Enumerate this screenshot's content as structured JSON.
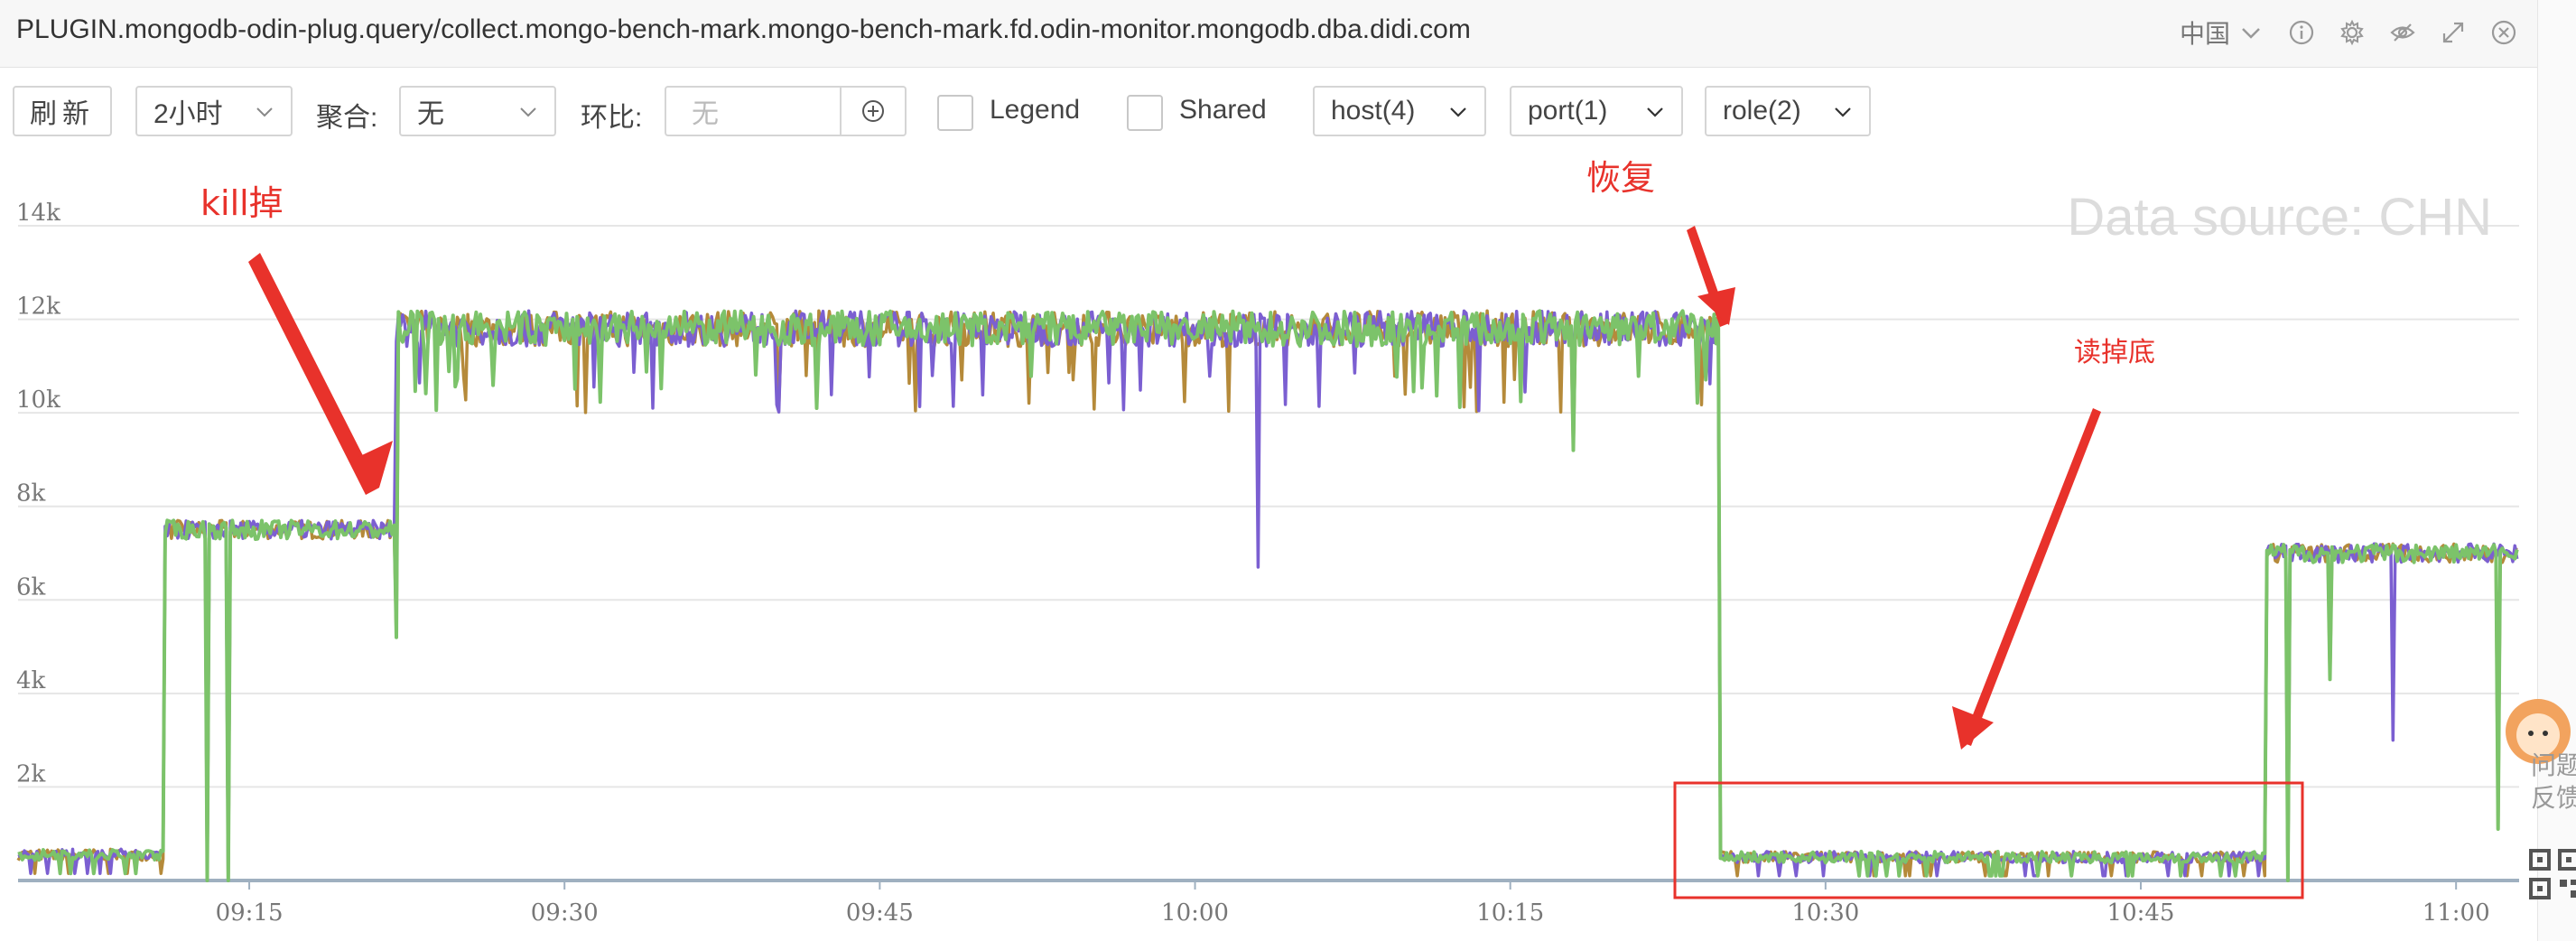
{
  "window": {
    "title": "PLUGIN.mongodb-odin-plug.query/collect.mongo-bench-mark.mongo-bench-mark.fd.odin-monitor.mongodb.dba.didi.com",
    "region_label": "中国",
    "icons": [
      "chevron-down-icon",
      "info-icon",
      "gear-icon",
      "eye-off-icon",
      "expand-icon",
      "close-icon"
    ]
  },
  "toolbar": {
    "refresh_label": "刷新",
    "range_value": "2小时",
    "aggregate_label": "聚合:",
    "aggregate_value": "无",
    "compare_label": "环比:",
    "compare_placeholder": "无",
    "legend_label": "Legend",
    "legend_checked": false,
    "shared_label": "Shared",
    "shared_checked": false,
    "host_filter": "host(4)",
    "port_filter": "port(1)",
    "role_filter": "role(2)"
  },
  "annotations": {
    "kill_label": "kill掉",
    "recover_label": "恢复",
    "bottom_label": "读掉底",
    "accent_color": "#e8322b"
  },
  "side_widget": {
    "label_top": "问题",
    "label_bottom": "反馈"
  },
  "chart_data": {
    "type": "line",
    "watermark": "Data source: CHN",
    "y_ticks": [
      "14k",
      "12k",
      "10k",
      "8k",
      "6k",
      "4k",
      "2k"
    ],
    "ylim": [
      0,
      14000
    ],
    "x_ticks": [
      "09:15",
      "09:30",
      "09:45",
      "10:00",
      "10:15",
      "10:30",
      "10:45",
      "11:00"
    ],
    "xlim": [
      "09:04",
      "11:03"
    ],
    "grid": true,
    "legend": "hidden",
    "series": [
      {
        "color": "#b58a3a",
        "key": "s1"
      },
      {
        "color": "#7b5fd1",
        "key": "s2"
      },
      {
        "color": "#7cc36a",
        "key": "s3"
      }
    ],
    "segments": [
      {
        "from": "09:04",
        "to": "09:11",
        "value": 550
      },
      {
        "from": "09:11",
        "to": "09:22",
        "value": 7500
      },
      {
        "from": "09:22",
        "to": "10:25",
        "value": 11800
      },
      {
        "from": "10:25",
        "to": "10:51",
        "value": 500
      },
      {
        "from": "10:51",
        "to": "11:03",
        "value": 7000
      }
    ],
    "spikes": [
      {
        "time": "09:13",
        "value": 0
      },
      {
        "time": "09:14",
        "value": 0
      },
      {
        "time": "09:22",
        "value": 5200
      },
      {
        "time": "09:42",
        "value": 7000
      },
      {
        "time": "09:42",
        "value": 10100
      },
      {
        "time": "10:03",
        "value": 6700
      },
      {
        "time": "10:18",
        "value": 9200
      },
      {
        "time": "10:52",
        "value": 0
      },
      {
        "time": "10:54",
        "value": 4300
      },
      {
        "time": "10:57",
        "value": 3000
      },
      {
        "time": "11:02",
        "value": 1100
      }
    ]
  }
}
